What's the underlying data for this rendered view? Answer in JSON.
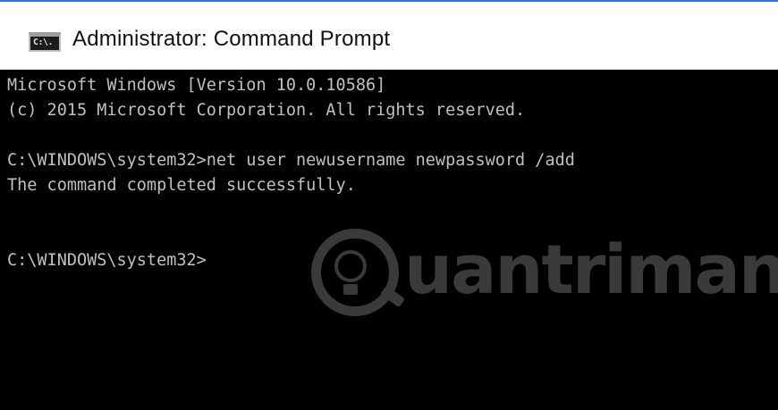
{
  "window": {
    "title": "Administrator: Command Prompt",
    "icon": "cmd-icon",
    "icon_text": "C:\\."
  },
  "console": {
    "lines": [
      "Microsoft Windows [Version 10.0.10586]",
      "(c) 2015 Microsoft Corporation. All rights reserved.",
      "",
      "C:\\WINDOWS\\system32>net user newusername newpassword /add",
      "The command completed successfully.",
      "",
      "",
      "C:\\WINDOWS\\system32>"
    ]
  },
  "watermark": {
    "text": "uantrimang"
  },
  "colors": {
    "console_bg": "#000000",
    "console_text": "#c0c0c0",
    "title_border": "#2b79d6"
  }
}
